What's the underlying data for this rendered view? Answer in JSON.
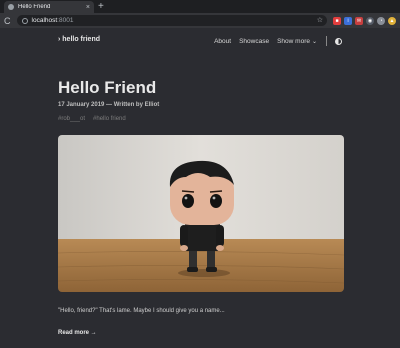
{
  "browser": {
    "tab_title": "Hello Friend",
    "tab_close": "×",
    "new_tab": "+",
    "reload": "C",
    "url_host": "localhost",
    "url_port": ":8001",
    "star": "☆",
    "extensions": [
      {
        "name": "ext-red",
        "color": "#e23d3d",
        "glyph": "■"
      },
      {
        "name": "ext-blue",
        "color": "#3b6fd8",
        "glyph": "i"
      },
      {
        "name": "ext-red2",
        "color": "#c73f3f",
        "glyph": "✉"
      },
      {
        "name": "ext-dark",
        "color": "#555b66",
        "glyph": "◉"
      },
      {
        "name": "ext-gray",
        "color": "#8a8f98",
        "glyph": "◔"
      },
      {
        "name": "ext-amber",
        "color": "#e0b13a",
        "glyph": "▲"
      }
    ]
  },
  "site": {
    "logo": "› hello friend",
    "nav": {
      "about": "About",
      "showcase": "Showcase",
      "show_more": "Show more",
      "chevron": "⌄"
    }
  },
  "post": {
    "title": "Hello Friend",
    "meta": "17 January 2019 — Written by Elliot",
    "tags": [
      "#rob___ot",
      "#hello friend"
    ],
    "excerpt": "\"Hello, friend?\" That's lame. Maybe I should give you a name...",
    "read_more": "Read more →"
  },
  "colors": {
    "background": "#2b2c31",
    "text": "#e6e6e6",
    "tag": "#7c7c7c"
  }
}
